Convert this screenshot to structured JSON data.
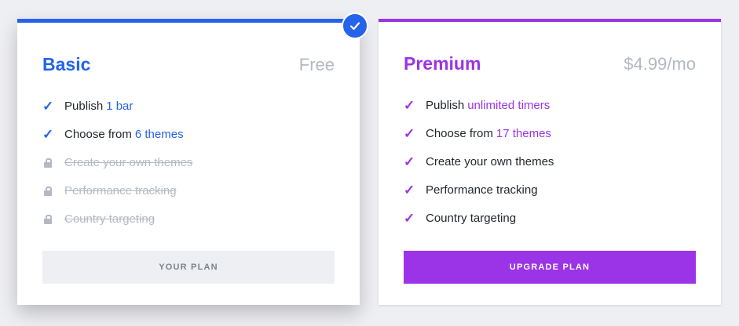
{
  "colors": {
    "basic_accent": "#2563eb",
    "premium_accent": "#9b33e6",
    "muted": "#b4b8c2"
  },
  "basic": {
    "name": "Basic",
    "price": "Free",
    "features": [
      {
        "prefix": "Publish",
        "highlight": "1 bar",
        "locked": false
      },
      {
        "prefix": "Choose from",
        "highlight": "6 themes",
        "locked": false
      },
      {
        "prefix": "Create your own themes",
        "highlight": "",
        "locked": true
      },
      {
        "prefix": "Performance tracking",
        "highlight": "",
        "locked": true
      },
      {
        "prefix": "Country targeting",
        "highlight": "",
        "locked": true
      }
    ],
    "button_label": "YOUR PLAN",
    "selected": true
  },
  "premium": {
    "name": "Premium",
    "price": "$4.99/mo",
    "features": [
      {
        "prefix": "Publish",
        "highlight": "unlimited timers",
        "locked": false
      },
      {
        "prefix": "Choose from",
        "highlight": "17 themes",
        "locked": false
      },
      {
        "prefix": "Create your own themes",
        "highlight": "",
        "locked": false
      },
      {
        "prefix": "Performance tracking",
        "highlight": "",
        "locked": false
      },
      {
        "prefix": "Country targeting",
        "highlight": "",
        "locked": false
      }
    ],
    "button_label": "UPGRADE PLAN"
  }
}
